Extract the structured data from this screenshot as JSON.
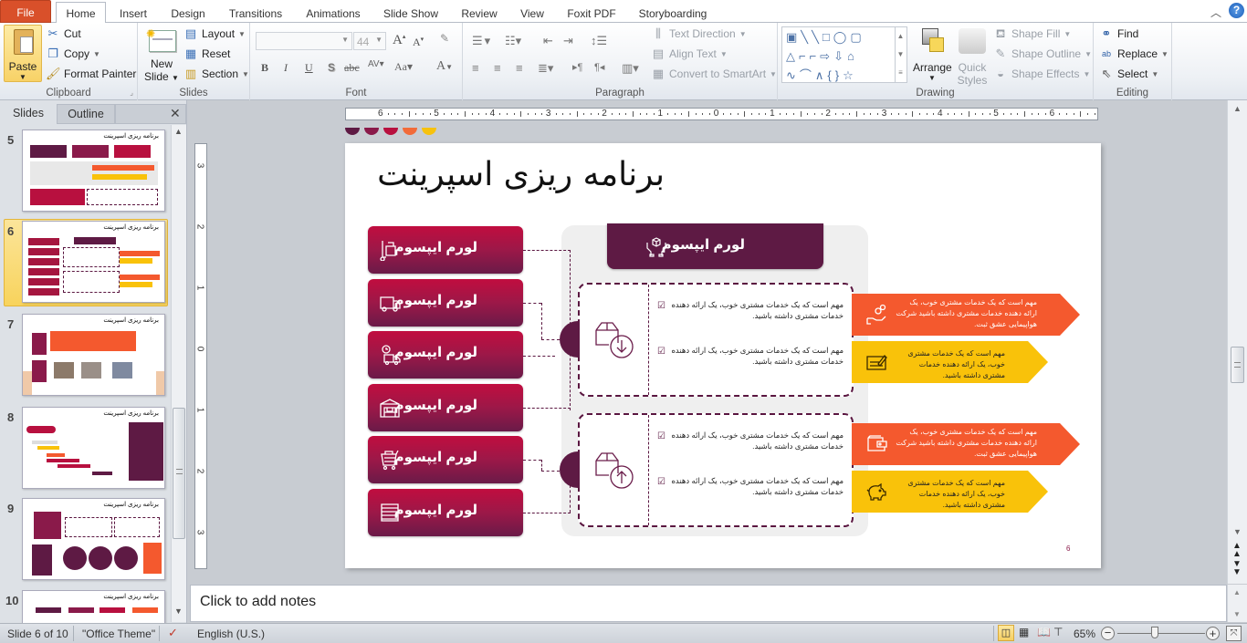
{
  "ribbon_tabs": [
    "File",
    "Home",
    "Insert",
    "Design",
    "Transitions",
    "Animations",
    "Slide Show",
    "Review",
    "View",
    "Foxit PDF",
    "Storyboarding"
  ],
  "active_tab": "Home",
  "clipboard": {
    "paste": "Paste",
    "cut": "Cut",
    "copy": "Copy",
    "format_painter": "Format Painter",
    "label": "Clipboard"
  },
  "slides_group": {
    "new_slide_1": "New",
    "new_slide_2": "Slide",
    "layout": "Layout",
    "reset": "Reset",
    "section": "Section",
    "label": "Slides"
  },
  "font_group": {
    "font_name": "",
    "font_size": "44",
    "label": "Font",
    "bold": "B",
    "italic": "I",
    "underline": "U",
    "shadow": "S",
    "strike": "abc",
    "spacing": "AV",
    "case": "Aa",
    "grow": "A",
    "shrink": "A",
    "color": "A"
  },
  "paragraph_group": {
    "text_direction": "Text Direction",
    "align_text": "Align Text",
    "convert_smartart": "Convert to SmartArt",
    "label": "Paragraph"
  },
  "drawing_group": {
    "arrange": "Arrange",
    "quick_styles_1": "Quick",
    "quick_styles_2": "Styles",
    "shape_fill": "Shape Fill",
    "shape_outline": "Shape Outline",
    "shape_effects": "Shape Effects",
    "label": "Drawing"
  },
  "editing_group": {
    "find": "Find",
    "replace": "Replace",
    "select": "Select",
    "label": "Editing"
  },
  "pane_tabs": {
    "slides": "Slides",
    "outline": "Outline"
  },
  "thumbnails": [
    {
      "num": "5",
      "title": "برنامه ریزی اسپرینت"
    },
    {
      "num": "6",
      "title": "برنامه ریزی اسپرینت",
      "selected": true
    },
    {
      "num": "7",
      "title": "برنامه ریزی اسپرینت"
    },
    {
      "num": "8",
      "title": "برنامه ریزی اسپرینت"
    },
    {
      "num": "9",
      "title": "برنامه ریزی اسپرینت"
    },
    {
      "num": "10",
      "title": "برنامه ریزی اسپرینت"
    }
  ],
  "ruler": {
    "h_labels": [
      "6",
      "5",
      "4",
      "3",
      "2",
      "1",
      "0",
      "1",
      "2",
      "3",
      "4",
      "5",
      "6"
    ],
    "v_labels": [
      "3",
      "2",
      "1",
      "0",
      "1",
      "2",
      "3"
    ]
  },
  "palette": [
    "#5e1a44",
    "#8a1a4a",
    "#b8103f",
    "#f26b3a",
    "#f7c20e"
  ],
  "slide": {
    "title": "برنامه ریزی اسپرینت",
    "left_cards": [
      {
        "label": "لورم ایپسوم",
        "icon": "hand-truck-icon"
      },
      {
        "label": "لورم ایپسوم",
        "icon": "delivery-truck-icon"
      },
      {
        "label": "لورم ایپسوم",
        "icon": "timed-delivery-icon"
      },
      {
        "label": "لورم ایپسوم",
        "icon": "warehouse-icon"
      },
      {
        "label": "لورم ایپسوم",
        "icon": "shopping-cart-icon"
      },
      {
        "label": "لورم ایپسوم",
        "icon": "shutter-icon"
      }
    ],
    "header_card": {
      "label": "لورم ایپسوم",
      "icon": "hands-box-icon"
    },
    "panels": [
      {
        "icon": "box-download-icon",
        "points": [
          "مهم است که یک خدمات مشتری خوب، یک ارائه دهنده خدمات مشتری داشته باشید.",
          "مهم است که یک خدمات مشتری خوب، یک ارائه دهنده خدمات مشتری داشته باشید."
        ]
      },
      {
        "icon": "box-upload-icon",
        "points": [
          "مهم است که یک خدمات مشتری خوب، یک ارائه دهنده خدمات مشتری داشته باشید.",
          "مهم است که یک خدمات مشتری خوب، یک ارائه دهنده خدمات مشتری داشته باشید."
        ]
      }
    ],
    "arrows": [
      {
        "color": "#f4592e",
        "text": "مهم است که یک خدمات مشتری خوب، یک ارائه دهنده خدمات مشتری داشته باشید شرکت هواپیمایی عشق ثبت.",
        "icon": "hand-coins-icon",
        "light": true
      },
      {
        "color": "#f9c20a",
        "text": "مهم است که یک خدمات مشتری خوب، یک ارائه دهنده خدمات مشتری داشته باشید.",
        "icon": "cheque-icon",
        "light": false
      },
      {
        "color": "#f4592e",
        "text": "مهم است که یک خدمات مشتری خوب، یک ارائه دهنده خدمات مشتری داشته باشید شرکت هواپیمایی عشق ثبت.",
        "icon": "wallet-icon",
        "light": true
      },
      {
        "color": "#f9c20a",
        "text": "مهم است که یک خدمات مشتری خوب، یک ارائه دهنده خدمات مشتری داشته باشید.",
        "icon": "piggy-bank-icon",
        "light": false
      }
    ],
    "page_number": "6"
  },
  "notes_placeholder": "Click to add notes",
  "status": {
    "slide_info": "Slide 6 of 10",
    "theme": "\"Office Theme\"",
    "language": "English (U.S.)",
    "zoom": "65%",
    "zoom_fraction": 0.43
  }
}
